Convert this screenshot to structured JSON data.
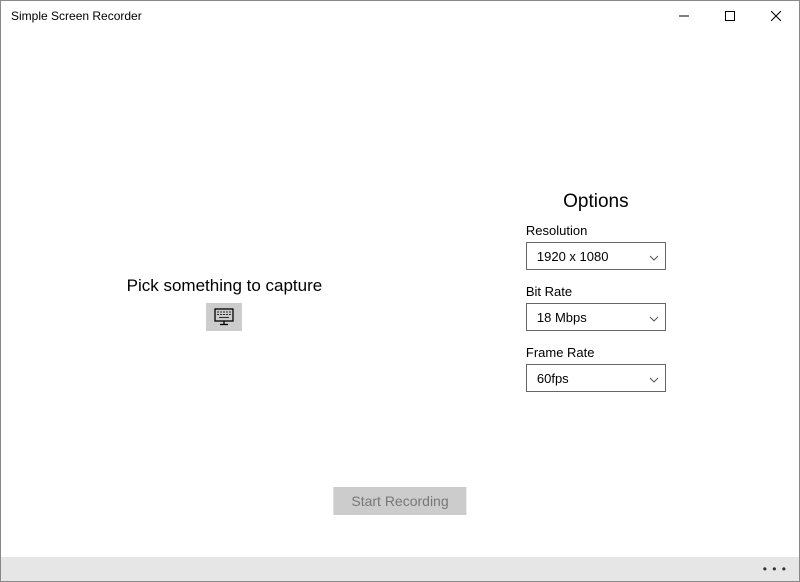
{
  "window": {
    "title": "Simple Screen Recorder"
  },
  "capture": {
    "heading": "Pick something to capture"
  },
  "options": {
    "title": "Options",
    "resolution": {
      "label": "Resolution",
      "value": "1920 x 1080"
    },
    "bitrate": {
      "label": "Bit Rate",
      "value": "18 Mbps"
    },
    "framerate": {
      "label": "Frame Rate",
      "value": "60fps"
    }
  },
  "actions": {
    "start_recording": "Start Recording"
  }
}
